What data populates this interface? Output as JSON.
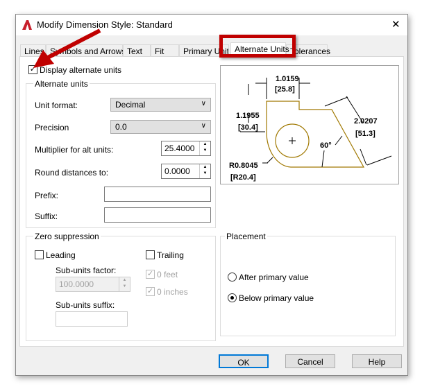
{
  "window": {
    "title": "Modify Dimension Style: Standard",
    "close": "✕"
  },
  "tabs": [
    "Lines",
    "Symbols and Arrows",
    "Text",
    "Fit",
    "Primary Units",
    "Alternate Units",
    "Tolerances"
  ],
  "display_alt": {
    "label": "Display alternate units",
    "checked": true
  },
  "alt_units": {
    "title": "Alternate units",
    "unit_format_label": "Unit format:",
    "unit_format": "Decimal",
    "precision_label": "Precision",
    "precision": "0.0",
    "multiplier_label": "Multiplier for alt units:",
    "multiplier": "25.4000",
    "round_label": "Round distances  to:",
    "round": "0.0000",
    "prefix_label": "Prefix:",
    "prefix": "",
    "suffix_label": "Suffix:",
    "suffix": ""
  },
  "zero": {
    "title": "Zero suppression",
    "leading": "Leading",
    "trailing": "Trailing",
    "subunits_factor_label": "Sub-units factor:",
    "subunits_factor": "100.0000",
    "subunits_suffix_label": "Sub-units suffix:",
    "feet": "0 feet",
    "inches": "0 inches"
  },
  "placement": {
    "title": "Placement",
    "after": "After primary value",
    "below": "Below primary value",
    "selected": "below"
  },
  "preview": {
    "d1": "1.0159",
    "d1b": "[25.8]",
    "d2": "1.1955",
    "d2b": "[30.4]",
    "d3": "2.0207",
    "d3b": "[51.3]",
    "angle": "60°",
    "r": "R0.8045",
    "rb": "[R20.4]"
  },
  "buttons": {
    "ok": "OK",
    "cancel": "Cancel",
    "help": "Help"
  },
  "colors": {
    "highlight": "#c00000",
    "shape": "#a07800"
  }
}
